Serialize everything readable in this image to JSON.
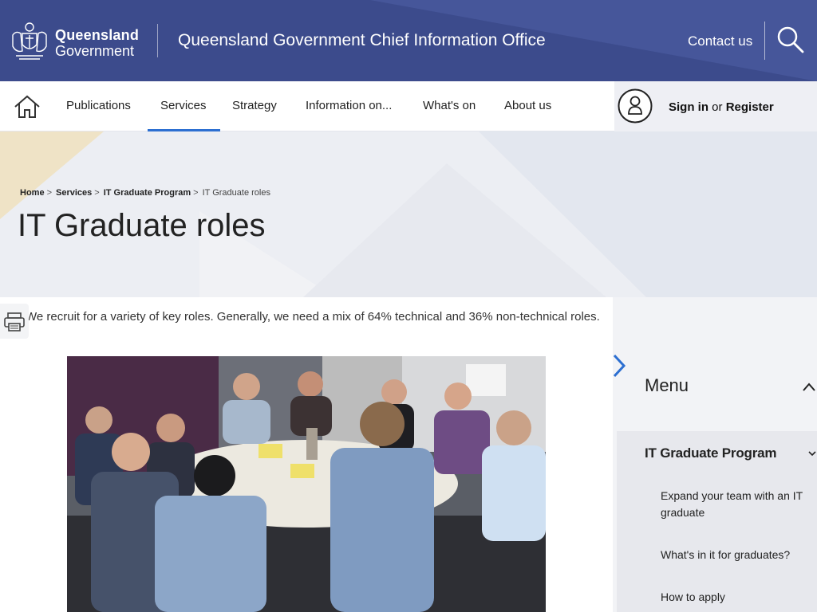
{
  "header": {
    "logo_line1": "Queensland",
    "logo_line2": "Government",
    "site_title": "Queensland Government Chief Information Office",
    "contact_label": "Contact us",
    "search_icon": "search-icon",
    "bg_color": "#3c4b8c"
  },
  "nav": {
    "home_icon": "home-icon",
    "items": [
      {
        "label": "Publications"
      },
      {
        "label": "Services",
        "active": true
      },
      {
        "label": "Strategy"
      },
      {
        "label": "Information on..."
      },
      {
        "label": "What's on"
      },
      {
        "label": "About us"
      }
    ],
    "sign_in_label": "Sign in",
    "or_label": "or",
    "register_label": "Register",
    "accent_color": "#2c6fd1"
  },
  "breadcrumb": {
    "items": [
      "Home",
      "Services",
      "IT Graduate Program"
    ],
    "current": "IT Graduate roles"
  },
  "page": {
    "title": "IT Graduate roles",
    "intro": "We recruit for a variety of key roles. Generally, we need a mix of 64% technical and 36% non-technical roles."
  },
  "sidebar": {
    "menu_title": "Menu",
    "section_title": "IT Graduate Program",
    "links": [
      "Expand your team with an IT graduate",
      "What's in it for graduates?",
      "How to apply"
    ]
  }
}
